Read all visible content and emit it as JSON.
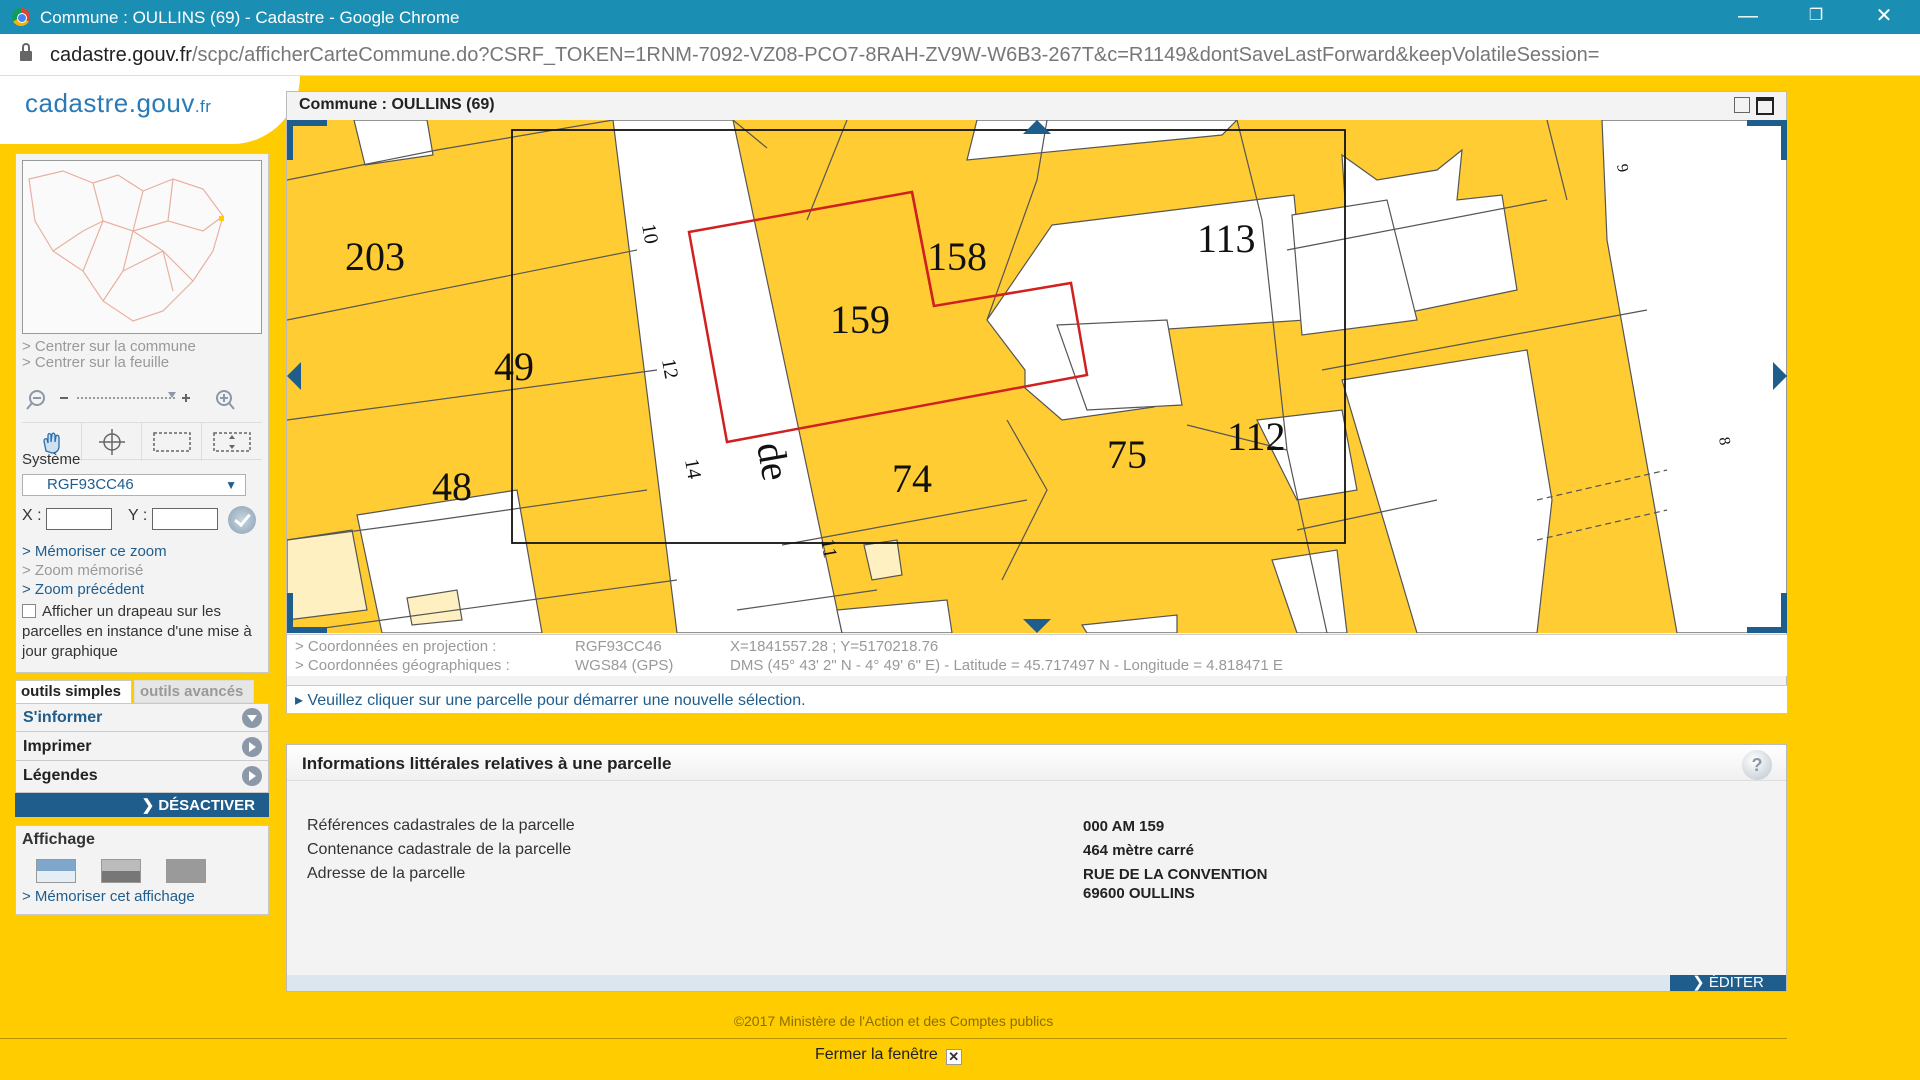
{
  "browser": {
    "title": "Commune : OULLINS (69) - Cadastre - Google Chrome",
    "url_host": "cadastre.gouv.fr",
    "url_path": "/scpc/afficherCarteCommune.do?CSRF_TOKEN=1RNM-7092-VZ08-PCO7-8RAH-ZV9W-W6B3-267T&c=R1149&dontSaveLastForward&keepVolatileSession="
  },
  "logo": {
    "main": "cadastre.gouv",
    "suffix": ".fr"
  },
  "left_panel": {
    "links": {
      "center_commune": "> Centrer sur la commune",
      "center_sheet": "> Centrer sur la feuille",
      "memorize_zoom": "> Mémoriser ce zoom",
      "memorized_zoom": "> Zoom mémorisé",
      "previous_zoom": "> Zoom précédent"
    },
    "systeme_label": "Système",
    "systeme_value": "RGF93CC46",
    "x_label": "X :",
    "y_label": "Y :",
    "flag_checkbox_label": "Afficher un drapeau sur les parcelles en instance d'une mise à jour graphique"
  },
  "tabs": {
    "simple": "outils simples",
    "advanced": "outils avancés"
  },
  "tools": {
    "inform": "S'informer",
    "print": "Imprimer",
    "legends": "Légendes",
    "deactivate": "DÉSACTIVER"
  },
  "affichage": {
    "label": "Affichage",
    "memorize": "> Mémoriser cet affichage"
  },
  "map": {
    "title": "Commune : OULLINS (69)",
    "parcels": [
      "203",
      "49",
      "48",
      "158",
      "159",
      "113",
      "112",
      "75",
      "74"
    ],
    "street_numbers": [
      "10",
      "12",
      "14",
      "11",
      "9",
      "8"
    ],
    "street_label": "de"
  },
  "coords": {
    "proj_label": "> Coordonnées en projection :",
    "proj_system": "RGF93CC46",
    "proj_value": "X=1841557.28 ; Y=5170218.76",
    "geo_label": "> Coordonnées géographiques :",
    "geo_system": "WGS84 (GPS)",
    "geo_value": "DMS (45° 43' 2\" N - 4° 49' 6\" E) - Latitude = 45.717497 N - Longitude = 4.818471 E"
  },
  "status_message": "▸ Veuillez cliquer sur une parcelle pour démarrer une nouvelle sélection.",
  "info": {
    "title": "Informations littérales relatives à une parcelle",
    "rows": [
      {
        "label": "Références cadastrales de la parcelle",
        "value": "000 AM 159"
      },
      {
        "label": "Contenance cadastrale de la parcelle",
        "value": "464 mètre carré"
      },
      {
        "label": "Adresse de la parcelle",
        "value": "RUE DE LA CONVENTION",
        "value2": "69600 OULLINS"
      }
    ],
    "edit_label": "ÉDITER"
  },
  "footer": {
    "copyright": "©2017 Ministère de l'Action et des Comptes publics",
    "close": "Fermer la fenêtre"
  },
  "colors": {
    "accent": "#1f5d8c",
    "background": "#ffcc00",
    "parcel": "#ffcc33",
    "selected_outline": "#d02020"
  }
}
